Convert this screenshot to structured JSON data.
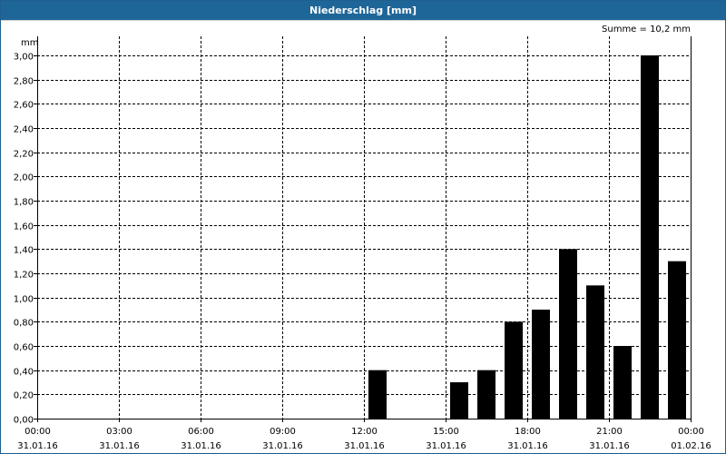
{
  "window": {
    "title": "Niederschlag [mm]"
  },
  "chart_data": {
    "type": "bar",
    "title": "Niederschlag [mm]",
    "unit_label": "mm",
    "sum_text": "Summe = 10,2 mm",
    "ylim": [
      0,
      3.0
    ],
    "y_ticks": [
      "0,00",
      "0,20",
      "0,40",
      "0,60",
      "0,80",
      "1,00",
      "1,20",
      "1,40",
      "1,60",
      "1,80",
      "2,00",
      "2,20",
      "2,40",
      "2,60",
      "2,80",
      "3,00"
    ],
    "xlim_hours": [
      0,
      24
    ],
    "x_ticks": [
      {
        "hour": 0,
        "time": "00:00",
        "date": "31.01.16"
      },
      {
        "hour": 3,
        "time": "03:00",
        "date": "31.01.16"
      },
      {
        "hour": 6,
        "time": "06:00",
        "date": "31.01.16"
      },
      {
        "hour": 9,
        "time": "09:00",
        "date": "31.01.16"
      },
      {
        "hour": 12,
        "time": "12:00",
        "date": "31.01.16"
      },
      {
        "hour": 15,
        "time": "15:00",
        "date": "31.01.16"
      },
      {
        "hour": 18,
        "time": "18:00",
        "date": "31.01.16"
      },
      {
        "hour": 21,
        "time": "21:00",
        "date": "31.01.16"
      },
      {
        "hour": 24,
        "time": "00:00",
        "date": "01.02.16"
      }
    ],
    "grid": true,
    "bar_color": "#000000",
    "bars": [
      {
        "hour": 12,
        "value": 0.4
      },
      {
        "hour": 15,
        "value": 0.3
      },
      {
        "hour": 16,
        "value": 0.4
      },
      {
        "hour": 17,
        "value": 0.8
      },
      {
        "hour": 18,
        "value": 0.9
      },
      {
        "hour": 19,
        "value": 1.4
      },
      {
        "hour": 20,
        "value": 1.1
      },
      {
        "hour": 21,
        "value": 0.6
      },
      {
        "hour": 22,
        "value": 3.0
      },
      {
        "hour": 23,
        "value": 1.3
      }
    ]
  }
}
